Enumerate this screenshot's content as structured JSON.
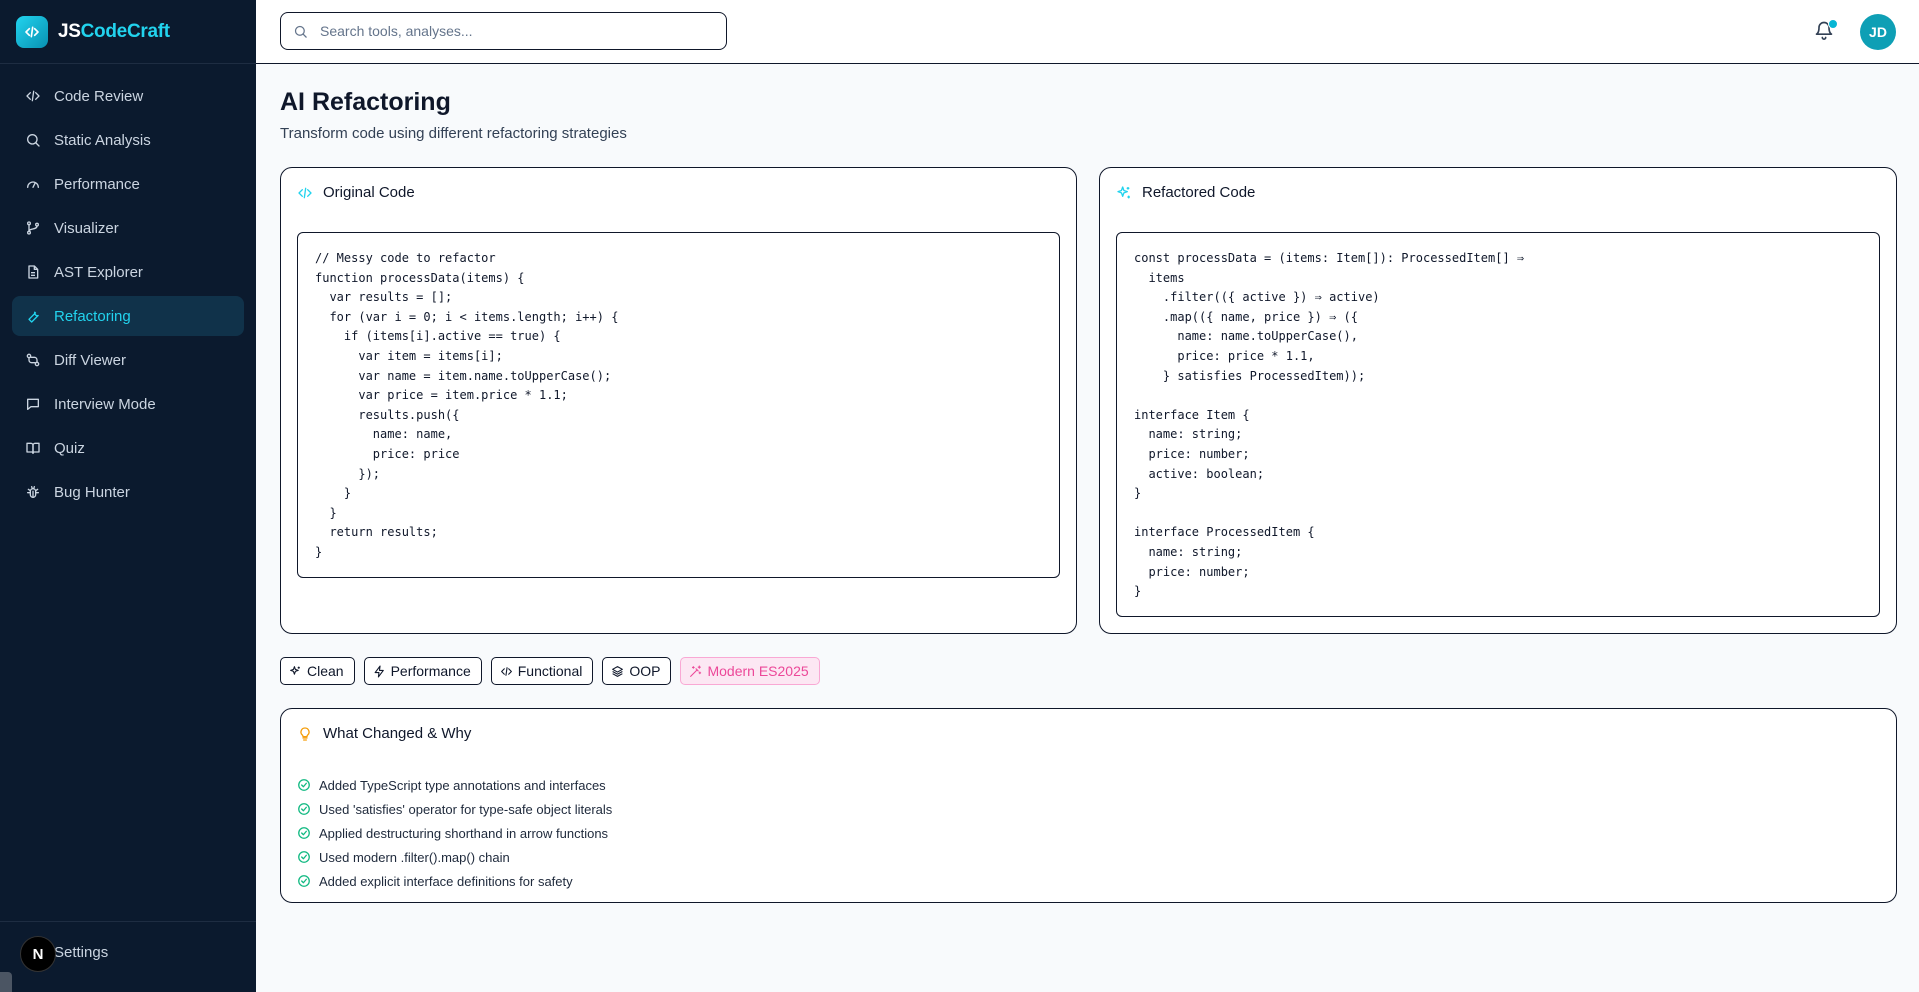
{
  "app": {
    "brand_part1": "JS",
    "brand_part2": "CodeCraft",
    "brand_color": "#22d3ee"
  },
  "sidebar": {
    "items": [
      {
        "label": "Code Review",
        "icon": "code-icon"
      },
      {
        "label": "Static Analysis",
        "icon": "search-icon"
      },
      {
        "label": "Performance",
        "icon": "gauge-icon"
      },
      {
        "label": "Visualizer",
        "icon": "git-branch-icon"
      },
      {
        "label": "AST Explorer",
        "icon": "file-code-icon"
      },
      {
        "label": "Refactoring",
        "icon": "wrench-icon",
        "active": true
      },
      {
        "label": "Diff Viewer",
        "icon": "diff-icon"
      },
      {
        "label": "Interview Mode",
        "icon": "message-icon"
      },
      {
        "label": "Quiz",
        "icon": "book-icon"
      },
      {
        "label": "Bug Hunter",
        "icon": "bug-icon"
      }
    ],
    "settings_label": "Settings",
    "dev_badge": "N"
  },
  "header": {
    "search_placeholder": "Search tools, analyses...",
    "avatar_initials": "JD"
  },
  "page": {
    "title": "AI Refactoring",
    "subtitle": "Transform code using different refactoring strategies"
  },
  "original": {
    "title": "Original Code",
    "code": "// Messy code to refactor\nfunction processData(items) {\n  var results = [];\n  for (var i = 0; i < items.length; i++) {\n    if (items[i].active == true) {\n      var item = items[i];\n      var name = item.name.toUpperCase();\n      var price = item.price * 1.1;\n      results.push({\n        name: name,\n        price: price\n      });\n    }\n  }\n  return results;\n}"
  },
  "refactored": {
    "title": "Refactored Code",
    "code": "const processData = (items: Item[]): ProcessedItem[] ⇒\n  items\n    .filter(({ active }) ⇒ active)\n    .map(({ name, price }) ⇒ ({\n      name: name.toUpperCase(),\n      price: price * 1.1,\n    } satisfies ProcessedItem));\n\ninterface Item {\n  name: string;\n  price: number;\n  active: boolean;\n}\n\ninterface ProcessedItem {\n  name: string;\n  price: number;\n}"
  },
  "strategies": [
    {
      "label": "Clean",
      "icon": "sparkles-icon"
    },
    {
      "label": "Performance",
      "icon": "zap-icon"
    },
    {
      "label": "Functional",
      "icon": "code-icon"
    },
    {
      "label": "OOP",
      "icon": "layers-icon"
    },
    {
      "label": "Modern ES2025",
      "icon": "wand-icon",
      "active": true
    }
  ],
  "changes": {
    "title": "What Changed & Why",
    "items": [
      "Added TypeScript type annotations and interfaces",
      "Used 'satisfies' operator for type-safe object literals",
      "Applied destructuring shorthand in arrow functions",
      "Used modern .filter().map() chain",
      "Added explicit interface definitions for safety"
    ]
  },
  "colors": {
    "accent": "#22d3ee",
    "sidebar_bg": "#0b1a2e",
    "active_strategy": "#ec4899",
    "check": "#10b981",
    "bulb": "#f59e0b"
  }
}
